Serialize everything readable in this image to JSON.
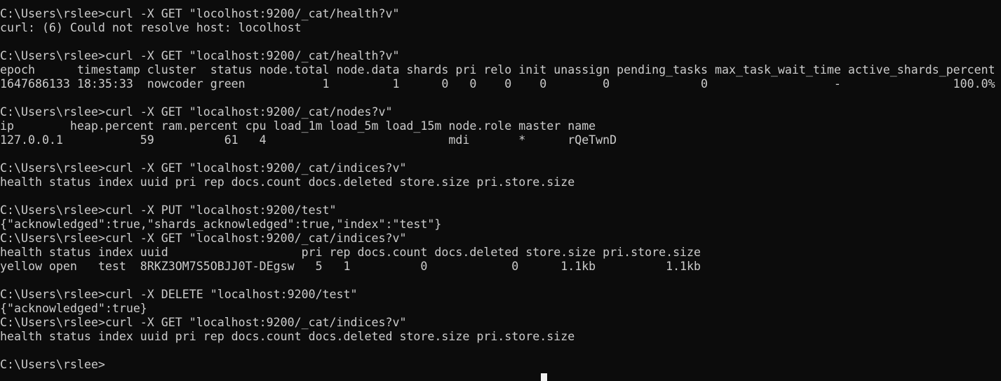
{
  "terminal": {
    "lines": [
      "C:\\Users\\rslee>curl -X GET \"locolhost:9200/_cat/health?v\"",
      "curl: (6) Could not resolve host: locolhost",
      "",
      "C:\\Users\\rslee>curl -X GET \"localhost:9200/_cat/health?v\"",
      "epoch      timestamp cluster  status node.total node.data shards pri relo init unassign pending_tasks max_task_wait_time active_shards_percent",
      "1647686133 18:35:33  nowcoder green           1         1      0   0    0    0        0             0                  -                100.0%",
      "",
      "C:\\Users\\rslee>curl -X GET \"localhost:9200/_cat/nodes?v\"",
      "ip        heap.percent ram.percent cpu load_1m load_5m load_15m node.role master name",
      "127.0.0.1           59          61   4                          mdi       *      rQeTwnD",
      "",
      "C:\\Users\\rslee>curl -X GET \"localhost:9200/_cat/indices?v\"",
      "health status index uuid pri rep docs.count docs.deleted store.size pri.store.size",
      "",
      "C:\\Users\\rslee>curl -X PUT \"localhost:9200/test\"",
      "{\"acknowledged\":true,\"shards_acknowledged\":true,\"index\":\"test\"}",
      "C:\\Users\\rslee>curl -X GET \"localhost:9200/_cat/indices?v\"",
      "health status index uuid                   pri rep docs.count docs.deleted store.size pri.store.size",
      "yellow open   test  8RKZ3OM7S5OBJJ0T-DEgsw   5   1          0            0      1.1kb          1.1kb",
      "",
      "C:\\Users\\rslee>curl -X DELETE \"localhost:9200/test\"",
      "{\"acknowledged\":true}",
      "C:\\Users\\rslee>curl -X GET \"localhost:9200/_cat/indices?v\"",
      "health status index uuid pri rep docs.count docs.deleted store.size pri.store.size",
      "",
      "C:\\Users\\rslee>"
    ]
  },
  "colors": {
    "background": "#0c0c0c",
    "text": "#cccccc",
    "cursor": "#f2f2f2"
  }
}
